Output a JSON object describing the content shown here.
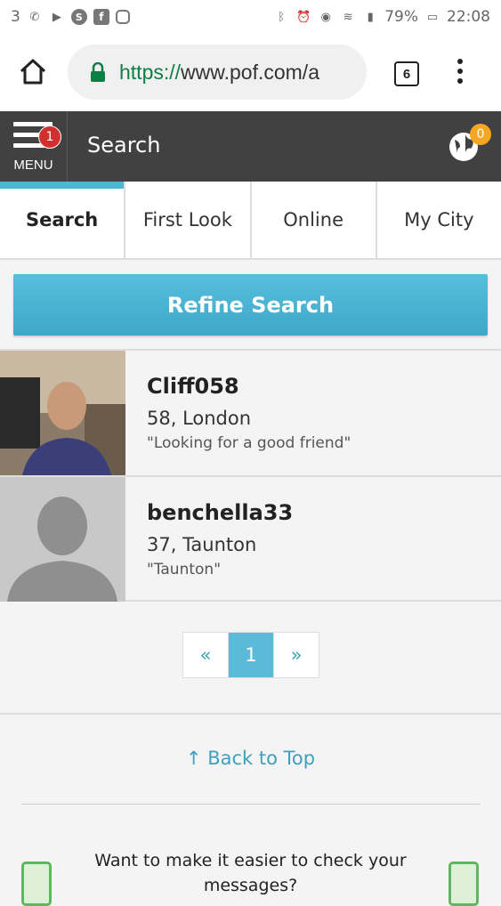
{
  "status_bar": {
    "left_text": "3",
    "battery": "79%",
    "time": "22:08"
  },
  "browser": {
    "url_scheme": "https://",
    "url_rest": "www.pof.com/a",
    "tab_count": "6"
  },
  "app_bar": {
    "menu_label": "MENU",
    "menu_badge": "1",
    "title": "Search",
    "globe_badge": "0"
  },
  "tabs": [
    {
      "label": "Search"
    },
    {
      "label": "First Look"
    },
    {
      "label": "Online"
    },
    {
      "label": "My City"
    }
  ],
  "refine_label": "Refine Search",
  "results": [
    {
      "name": "Cliff058",
      "location": "58, London",
      "quote": "\"Looking for a good friend\""
    },
    {
      "name": "benchella33",
      "location": "37, Taunton",
      "quote": "\"Taunton\""
    }
  ],
  "pagination": {
    "prev": "«",
    "current": "1",
    "next": "»"
  },
  "back_to_top": "Back to Top",
  "back_to_top_arrow": "↑",
  "promo_text": "Want to make it easier to check your messages?",
  "colors": {
    "accent": "#4eb3d3",
    "appbar": "#414141",
    "url_green": "#0b8043"
  }
}
